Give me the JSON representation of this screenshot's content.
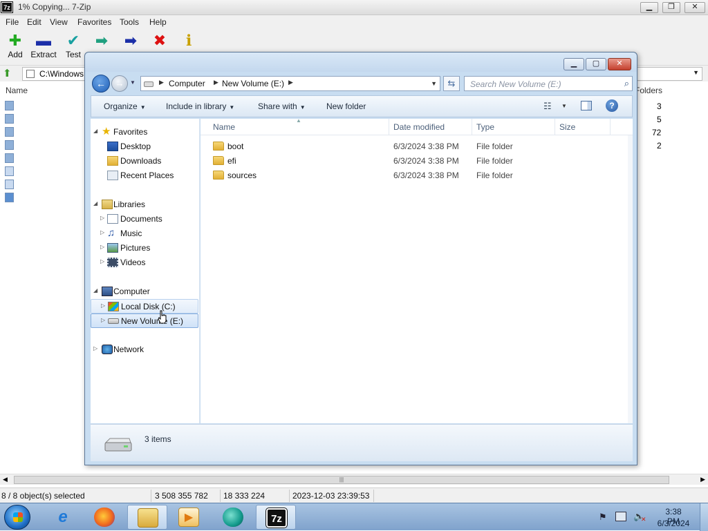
{
  "zip": {
    "title": "1% Copying... 7-Zip",
    "app_icon": "7z",
    "menu": [
      "File",
      "Edit",
      "View",
      "Favorites",
      "Tools",
      "Help"
    ],
    "toolbar": {
      "add": "Add",
      "extract": "Extract",
      "test": "Test",
      "icons": [
        "plus-icon",
        "minus-icon",
        "check-icon",
        "copy-arrow-icon",
        "move-arrow-icon",
        "delete-x-icon",
        "info-icon"
      ],
      "colors": {
        "add": "#22aa22",
        "extract": "#1c2fa8",
        "test": "#18a0a0",
        "copy": "#20a080",
        "move": "#1c2fa8",
        "delete": "#dd1111",
        "info": "#c8a000"
      }
    },
    "path": "C:\\Windows",
    "columns": {
      "name": "Name",
      "folders": "Folders"
    },
    "folder_counts": [
      "3",
      "5",
      "72",
      "2"
    ],
    "status": {
      "selected": "8 / 8 object(s) selected",
      "size": "3 508 355 782",
      "packed": "18 333 224",
      "modified": "2023-12-03 23:39:53"
    }
  },
  "explorer": {
    "breadcrumb": [
      "Computer",
      "New Volume (E:)"
    ],
    "search_placeholder": "Search New Volume (E:)",
    "commands": {
      "organize": "Organize",
      "include": "Include in library",
      "share": "Share with",
      "new_folder": "New folder"
    },
    "nav": {
      "favorites": "Favorites",
      "desktop": "Desktop",
      "downloads": "Downloads",
      "recent": "Recent Places",
      "libraries": "Libraries",
      "documents": "Documents",
      "music": "Music",
      "pictures": "Pictures",
      "videos": "Videos",
      "computer": "Computer",
      "local_disk": "Local Disk (C:)",
      "new_volume": "New Volume (E:)",
      "network": "Network"
    },
    "columns": {
      "name": "Name",
      "date": "Date modified",
      "type": "Type",
      "size": "Size"
    },
    "files": [
      {
        "name": "boot",
        "date": "6/3/2024 3:38 PM",
        "type": "File folder"
      },
      {
        "name": "efi",
        "date": "6/3/2024 3:38 PM",
        "type": "File folder"
      },
      {
        "name": "sources",
        "date": "6/3/2024 3:38 PM",
        "type": "File folder"
      }
    ],
    "item_count": "3 items"
  },
  "taskbar": {
    "apps": [
      "internet-explorer-icon",
      "firefox-icon",
      "file-explorer-icon",
      "media-player-icon",
      "chat-app-icon",
      "7zip-icon"
    ],
    "seven_zip_label": "7z",
    "clock_time": "3:38 PM",
    "clock_date": "6/3/2024"
  }
}
